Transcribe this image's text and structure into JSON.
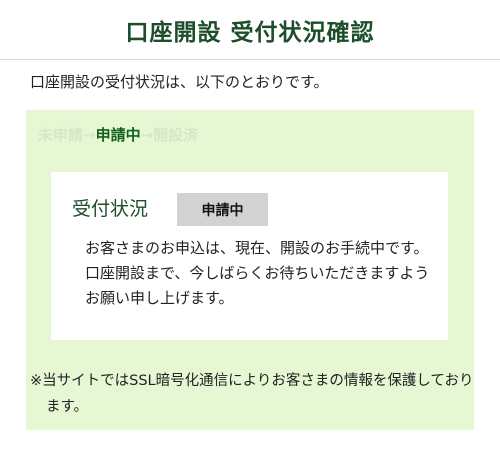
{
  "header": {
    "title": "口座開設 受付状況確認"
  },
  "intro": {
    "text": "口座開設の受付状況は、以下のとおりです。"
  },
  "steps": [
    {
      "label": "未申請",
      "state": "done"
    },
    {
      "label": "申請中",
      "state": "current"
    },
    {
      "label": "開設済",
      "state": "pending"
    }
  ],
  "step_arrow": "→",
  "status_card": {
    "title": "受付状況",
    "badge": "申請中",
    "message": "お客さまのお申込は、現在、開設のお手続中です。口座開設まで、今しばらくお待ちいただきますようお願い申し上げます。"
  },
  "notice": {
    "text": "※当サイトではSSL暗号化通信によりお客さまの情報を保護しております。"
  },
  "colors": {
    "brand_green": "#1e4d2b",
    "panel_bg": "#e6f7d4",
    "badge_bg": "#d2d2d2",
    "step_active": "#12621f",
    "step_dim": "#d7e7c6"
  }
}
